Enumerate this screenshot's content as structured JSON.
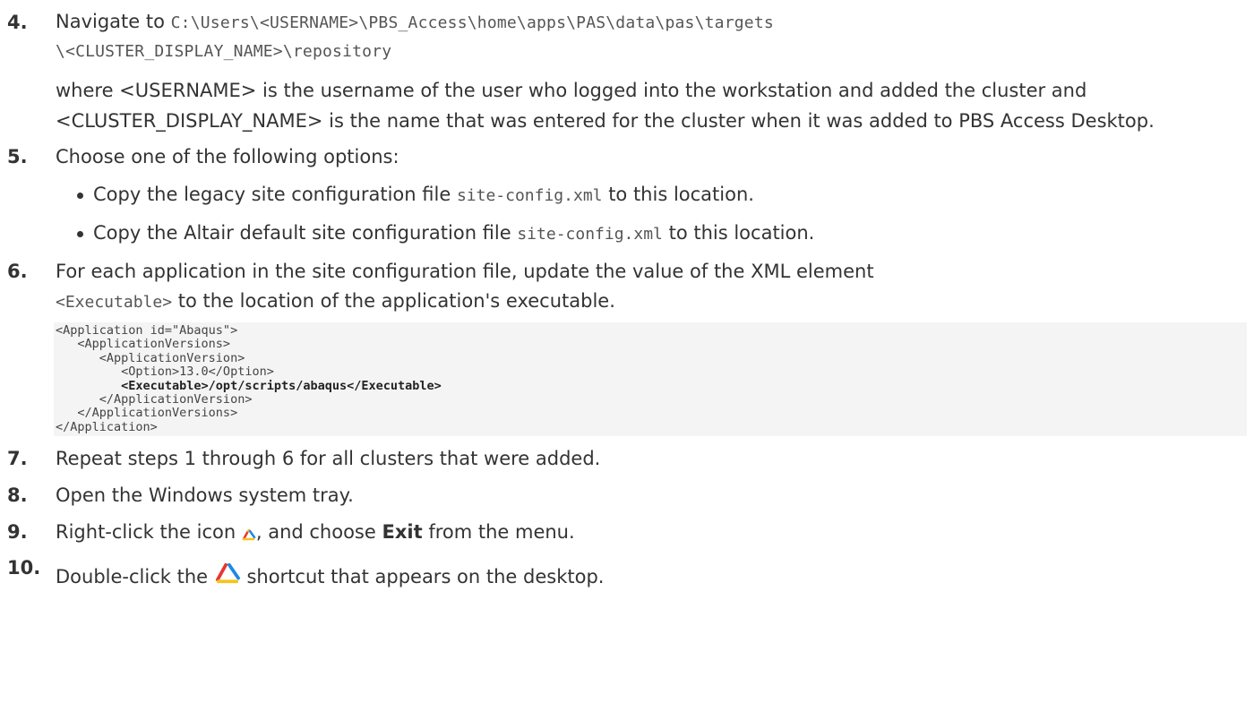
{
  "steps": {
    "s4": {
      "num": "4.",
      "navigate": "Navigate to",
      "path_line1": "C:\\Users\\<USERNAME>\\PBS_Access\\home\\apps\\PAS\\data\\pas\\targets",
      "path_line2": "\\<CLUSTER_DISPLAY_NAME>\\repository",
      "desc": "where <USERNAME> is the username of the user who logged into the workstation and added the cluster and <CLUSTER_DISPLAY_NAME> is the name that was entered for the cluster when it was added to PBS Access Desktop."
    },
    "s5": {
      "num": "5.",
      "text": "Choose one of the following options:",
      "bullet1_pre": "Copy the legacy site configuration file",
      "bullet1_code": "site-config.xml",
      "bullet1_post": "to this location.",
      "bullet2_pre": "Copy the Altair default site configuration file",
      "bullet2_code": "site-config.xml",
      "bullet2_post": "to this location."
    },
    "s6": {
      "num": "6.",
      "line1": "For each application in the site configuration file, update the value of the XML element",
      "code": "<Executable>",
      "line2_post": "to the location of the application's executable.",
      "codeblock": [
        "<Application id=\"Abaqus\">",
        "   <ApplicationVersions>",
        "      <ApplicationVersion>",
        "         <Option>13.0</Option>",
        "         <Executable>/opt/scripts/abaqus</Executable>",
        "      </ApplicationVersion>",
        "   </ApplicationVersions>",
        "</Application>"
      ]
    },
    "s7": {
      "num": "7.",
      "text": "Repeat steps 1 through 6 for all clusters that were added."
    },
    "s8": {
      "num": "8.",
      "text": "Open the Windows system tray."
    },
    "s9": {
      "num": "9.",
      "pre": "Right-click the icon",
      "mid": ", and choose",
      "bold": "Exit",
      "post": "from the menu."
    },
    "s10": {
      "num": "10.",
      "pre": "Double-click the",
      "post": "shortcut that appears on the desktop."
    }
  },
  "icons": {
    "tray_icon": "pbs-access-tray-icon",
    "shortcut_icon": "pbs-access-shortcut-icon"
  },
  "colors": {
    "text": "#333333",
    "code_bg": "#f4f4f4",
    "icon_red": "#e8352f",
    "icon_yellow": "#f5c518",
    "icon_blue": "#1e88e5"
  }
}
